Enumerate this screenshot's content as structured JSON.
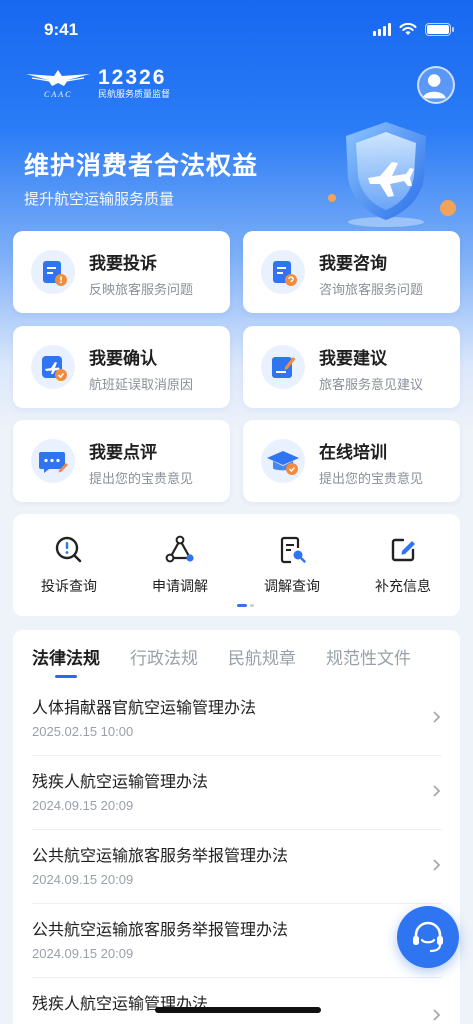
{
  "status_bar": {
    "time": "9:41"
  },
  "header": {
    "logo_caption": "CAAC",
    "hotline": "12326",
    "hotline_subtitle": "民航服务质量监督"
  },
  "hero": {
    "title": "维护消费者合法权益",
    "subtitle": "提升航空运输服务质量"
  },
  "service_cards": [
    {
      "title": "我要投诉",
      "desc": "反映旅客服务问题",
      "icon": "complaint-icon"
    },
    {
      "title": "我要咨询",
      "desc": "咨询旅客服务问题",
      "icon": "consult-icon"
    },
    {
      "title": "我要确认",
      "desc": "航班延误取消原因",
      "icon": "flight-confirm-icon"
    },
    {
      "title": "我要建议",
      "desc": "旅客服务意见建议",
      "icon": "suggestion-icon"
    },
    {
      "title": "我要点评",
      "desc": "提出您的宝贵意见",
      "icon": "review-icon"
    },
    {
      "title": "在线培训",
      "desc": "提出您的宝贵意见",
      "icon": "training-icon"
    }
  ],
  "quick_actions": [
    {
      "label": "投诉查询",
      "icon": "complaint-search-icon"
    },
    {
      "label": "申请调解",
      "icon": "mediation-icon"
    },
    {
      "label": "调解查询",
      "icon": "mediation-search-icon"
    },
    {
      "label": "补充信息",
      "icon": "edit-icon"
    }
  ],
  "tabs": [
    {
      "label": "法律法规",
      "active": true
    },
    {
      "label": "行政法规",
      "active": false
    },
    {
      "label": "民航规章",
      "active": false
    },
    {
      "label": "规范性文件",
      "active": false
    }
  ],
  "laws": [
    {
      "title": "人体捐献器官航空运输管理办法",
      "date": "2025.02.15 10:00"
    },
    {
      "title": "残疾人航空运输管理办法",
      "date": "2024.09.15 20:09"
    },
    {
      "title": "公共航空运输旅客服务举报管理办法",
      "date": "2024.09.15 20:09"
    },
    {
      "title": "公共航空运输旅客服务举报管理办法",
      "date": "2024.09.15 20:09"
    },
    {
      "title": "残疾人航空运输管理办法",
      "date": ""
    }
  ],
  "colors": {
    "brand": "#1f6ff2",
    "hero_top": "#1768f0",
    "accent_orange": "#f28b3c"
  }
}
